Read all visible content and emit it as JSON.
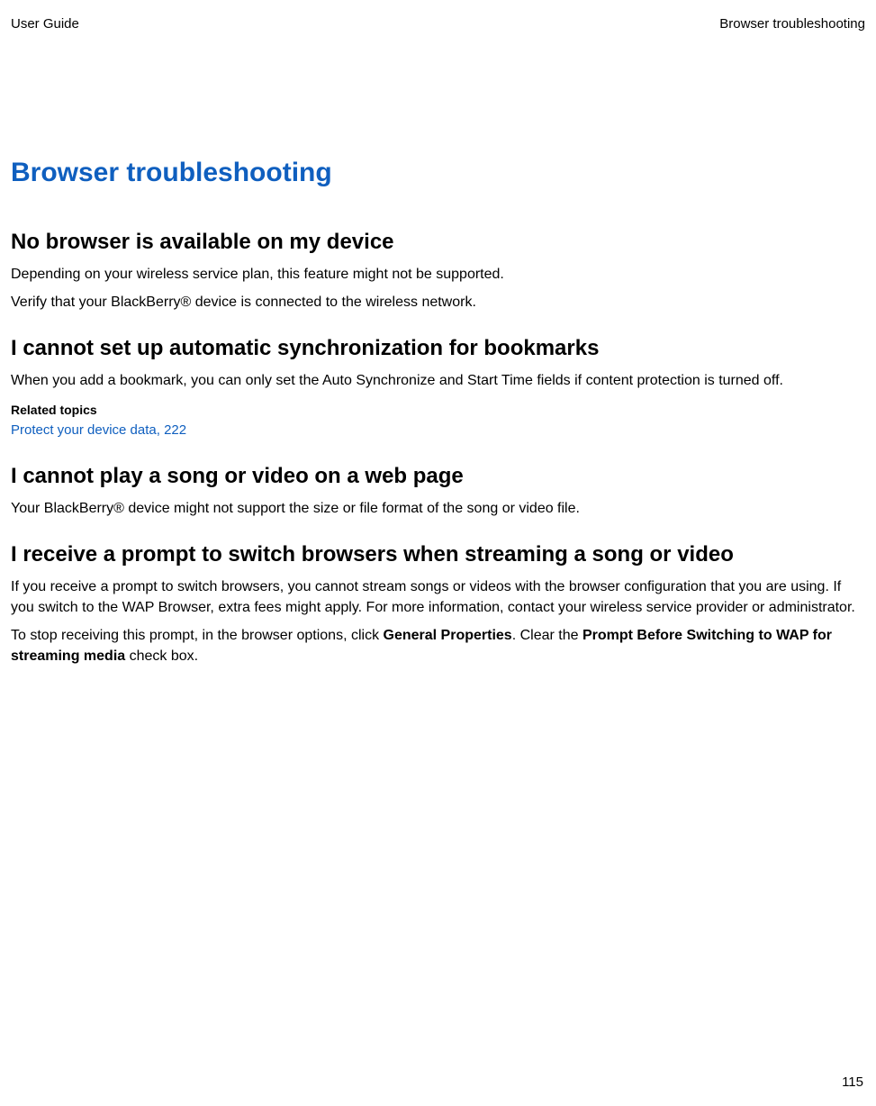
{
  "header": {
    "left": "User Guide",
    "right": "Browser troubleshooting"
  },
  "title": "Browser troubleshooting",
  "sections": {
    "s1": {
      "heading": "No browser is available on my device",
      "p1": "Depending on your wireless service plan, this feature might not be supported.",
      "p2": "Verify that your BlackBerry® device is connected to the wireless network."
    },
    "s2": {
      "heading": "I cannot set up automatic synchronization for bookmarks",
      "p1": "When you add a bookmark, you can only set the Auto Synchronize and Start Time fields if content protection is turned off.",
      "related_label": "Related topics",
      "related_link": "Protect your device data, 222"
    },
    "s3": {
      "heading": "I cannot play a song or video on a web page",
      "p1": "Your BlackBerry® device might not support the size or file format of the song or video file."
    },
    "s4": {
      "heading": "I receive a prompt to switch browsers when streaming a song or video",
      "p1": "If you receive a prompt to switch browsers, you cannot stream songs or videos with the browser configuration that you are using. If you switch to the WAP Browser, extra fees might apply. For more information, contact your wireless service provider or administrator.",
      "p2a": "To stop receiving this prompt, in the browser options, click ",
      "p2b": "General Properties",
      "p2c": ". Clear the ",
      "p2d": "Prompt Before Switching to WAP for streaming media",
      "p2e": " check box."
    }
  },
  "page_number": "115"
}
